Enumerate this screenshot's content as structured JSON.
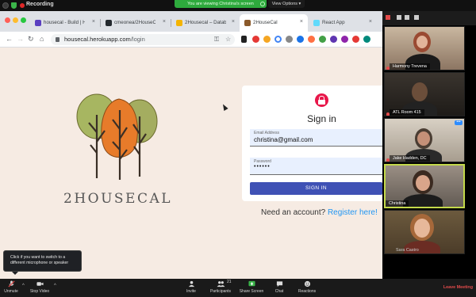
{
  "zoom": {
    "recording_label": "Recording",
    "viewing_banner": "You are viewing Christina's screen",
    "view_options_label": "View Options ▾",
    "participant_count": "21",
    "tooltip": "Click if you want to switch to a different microphone or speaker",
    "controls": {
      "unmute": "Unmute",
      "stop_video": "Stop Video",
      "invite": "Invite",
      "participants": "Participants",
      "share_screen": "Share Screen",
      "chat": "Chat",
      "reactions": "Reactions",
      "leave": "Leave Meeting"
    },
    "participants_list": [
      {
        "name": "Harmony Trevena"
      },
      {
        "name": "ATL Room 415"
      },
      {
        "name": "Jake Hadden, DC"
      },
      {
        "name": "Christina"
      },
      {
        "name": "Sara Castro"
      }
    ]
  },
  "browser": {
    "tabs": [
      {
        "title": "housecal - Build | He",
        "icon_color": "#5a3fc0"
      },
      {
        "title": "cmeonea/2HouseCa...",
        "icon_color": "#24292e"
      },
      {
        "title": "2Housecal – Databa...",
        "icon_color": "#f4b400"
      },
      {
        "title": "2HouseCal",
        "icon_color": "#8b5a2b"
      },
      {
        "title": "React App",
        "icon_color": "#61dafb"
      }
    ],
    "url_host": "housecal.herokuapp.com",
    "url_path": "/login",
    "close_glyph": "×",
    "nav": {
      "back": "←",
      "forward": "→",
      "reload": "↻",
      "home": "⌂"
    }
  },
  "page": {
    "brand": "2HOUSECAL",
    "signin_title": "Sign in",
    "email_label": "Email Address",
    "email_value": "christina@gmail.com",
    "password_label": "Password",
    "password_value": "••••••",
    "signin_button": "SIGN IN",
    "need_account": "Need an account?",
    "register_link": "Register here!"
  },
  "colors": {
    "page_bg": "#f6ebe3",
    "signin_button": "#3f51b5",
    "lock_badge": "#e8174a",
    "register_link": "#2196f3",
    "active_speaker_border": "#c3d94a",
    "viewing_banner": "#2eaa3d"
  },
  "icons": {
    "lock": "lock-icon",
    "mic": "mic-icon",
    "video": "video-camera-icon",
    "invite": "person-plus-icon",
    "participants": "people-icon",
    "share": "share-screen-icon",
    "chat": "chat-bubble-icon",
    "reactions": "smiley-plus-icon"
  }
}
